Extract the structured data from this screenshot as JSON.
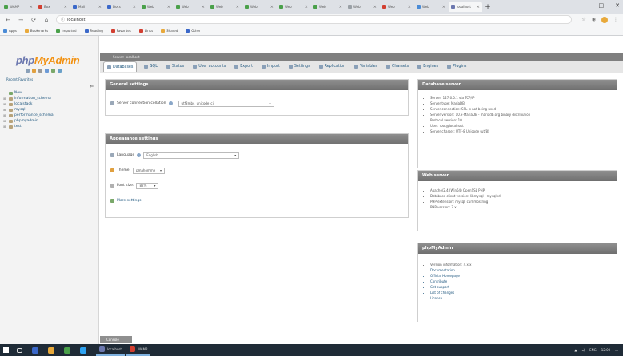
{
  "browser": {
    "tabs": [
      {
        "label": "WAMP",
        "color": "#4aa04a"
      },
      {
        "label": "Box",
        "color": "#d23f31"
      },
      {
        "label": "Mail",
        "color": "#3b68c9"
      },
      {
        "label": "Docs",
        "color": "#3b68c9"
      },
      {
        "label": "Web",
        "color": "#4aa04a"
      },
      {
        "label": "Web",
        "color": "#4aa04a"
      },
      {
        "label": "Web",
        "color": "#4aa04a"
      },
      {
        "label": "Web",
        "color": "#4aa04a"
      },
      {
        "label": "Web",
        "color": "#4aa04a"
      },
      {
        "label": "Web",
        "color": "#4aa04a"
      },
      {
        "label": "Web",
        "color": "#9aa0a6"
      },
      {
        "label": "Web",
        "color": "#d23f31"
      },
      {
        "label": "Web",
        "color": "#4a8bd6"
      },
      {
        "label": "localhost",
        "color": "#6c78af",
        "active": true
      }
    ],
    "new_tab": "+",
    "window_controls": [
      "–",
      "□",
      "✕"
    ],
    "address": "localhost",
    "nav": [
      "←",
      "→",
      "⟳",
      "⌂"
    ],
    "bookmarks": [
      {
        "label": "Apps",
        "color": "#4a8bd6"
      },
      {
        "label": "Bookmarks",
        "color": "#e8a93b"
      },
      {
        "label": "Imported",
        "color": "#4aa04a"
      },
      {
        "label": "Reading",
        "color": "#3b68c9"
      },
      {
        "label": "Favorites",
        "color": "#d23f31"
      },
      {
        "label": "Links",
        "color": "#d23f31"
      },
      {
        "label": "Shared",
        "color": "#e8a93b"
      },
      {
        "label": "Other",
        "color": "#3b68c9"
      }
    ]
  },
  "pma": {
    "logo_php": "php",
    "logo_ma": "MyAdmin",
    "recent_label": "Recent   Favorites",
    "collapse_icon": "⇐",
    "databases": [
      "New",
      "information_schema",
      "localstack",
      "mysql",
      "performance_schema",
      "phpmyadmin",
      "test"
    ],
    "server_bar": "Server: localhost",
    "tabs": [
      {
        "label": "Databases",
        "active": true
      },
      {
        "label": "SQL"
      },
      {
        "label": "Status"
      },
      {
        "label": "User accounts"
      },
      {
        "label": "Export"
      },
      {
        "label": "Import"
      },
      {
        "label": "Settings"
      },
      {
        "label": "Replication"
      },
      {
        "label": "Variables"
      },
      {
        "label": "Charsets"
      },
      {
        "label": "Engines"
      },
      {
        "label": "Plugins"
      }
    ],
    "general_settings": {
      "title": "General settings",
      "collation_label": "Server connection collation",
      "collation_value": "utf8mb4_unicode_ci"
    },
    "appearance_settings": {
      "title": "Appearance settings",
      "language_label": "Language",
      "language_value": "English",
      "theme_label": "Theme:",
      "theme_value": "pmahomme",
      "fontsize_label": "Font size:",
      "fontsize_value": "82%",
      "more_settings": "More settings"
    },
    "database_server": {
      "title": "Database server",
      "items": [
        "Server: 127.0.0.1 via TCP/IP",
        "Server type: MariaDB",
        "Server connection: SSL is not being used",
        "Server version: 10.x-MariaDB - mariadb.org binary distribution",
        "Protocol version: 10",
        "User: root@localhost",
        "Server charset: UTF-8 Unicode (utf8)"
      ]
    },
    "web_server": {
      "title": "Web server",
      "items": [
        "Apache/2.4 (Win64) OpenSSL PHP",
        "Database client version: libmysql - mysqlnd",
        "PHP extension: mysqli curl mbstring",
        "PHP version: 7.x"
      ]
    },
    "phpmyadmin_panel": {
      "title": "phpMyAdmin",
      "items": [
        "Version information: 4.x.x",
        "Documentation",
        "Official Homepage",
        "Contribute",
        "Get support",
        "List of changes",
        "License"
      ]
    },
    "console": "Console"
  },
  "taskbar": {
    "apps": [
      {
        "label": "localhost",
        "color": "#6c78af"
      },
      {
        "label": "WAMP",
        "color": "#d23f31"
      }
    ],
    "pinned": [
      "#3b68c9",
      "#e8a93b",
      "#4aa04a",
      "#2ea3f2"
    ],
    "tray_time": "12:00",
    "tray_lang": "ENG"
  }
}
